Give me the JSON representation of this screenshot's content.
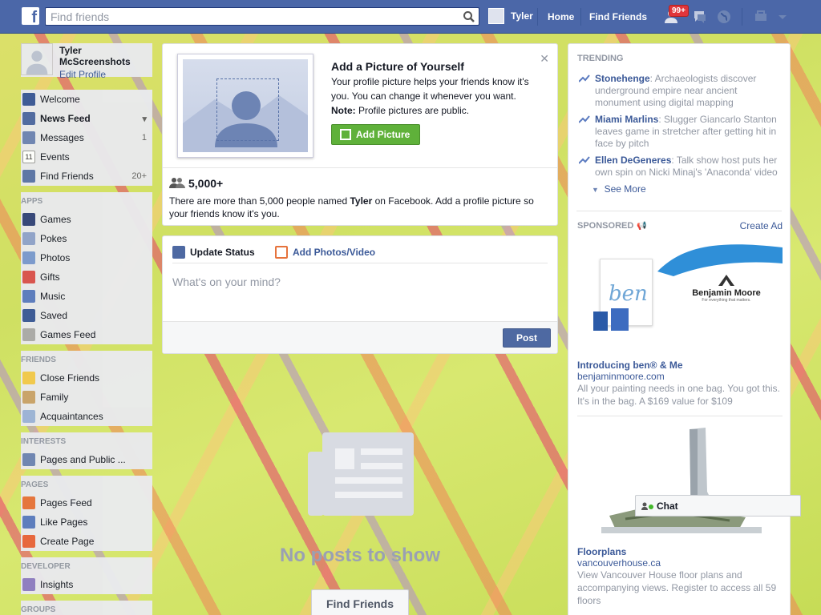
{
  "topbar": {
    "logo": "f",
    "search_placeholder": "Find friends",
    "user_name": "Tyler",
    "home_label": "Home",
    "find_friends_label": "Find Friends",
    "friend_requests_badge": "99+"
  },
  "left": {
    "profile_name": "Tyler McScreenshots",
    "edit_profile": "Edit Profile",
    "favorites": [
      {
        "label": "Welcome",
        "icon": "facebook-icon",
        "count": ""
      },
      {
        "label": "News Feed",
        "icon": "news-feed-icon",
        "count": ""
      },
      {
        "label": "Messages",
        "icon": "messages-icon",
        "count": "1"
      },
      {
        "label": "Events",
        "icon": "calendar-icon",
        "count": ""
      },
      {
        "label": "Find Friends",
        "icon": "find-friends-icon",
        "count": "20+"
      }
    ],
    "apps_header": "APPS",
    "apps": [
      {
        "label": "Games",
        "icon": "games-icon"
      },
      {
        "label": "Pokes",
        "icon": "pokes-icon"
      },
      {
        "label": "Photos",
        "icon": "photos-icon"
      },
      {
        "label": "Gifts",
        "icon": "gifts-icon"
      },
      {
        "label": "Music",
        "icon": "music-icon"
      },
      {
        "label": "Saved",
        "icon": "saved-icon"
      },
      {
        "label": "Games Feed",
        "icon": "gamepad-icon"
      }
    ],
    "friends_header": "FRIENDS",
    "friends": [
      {
        "label": "Close Friends",
        "icon": "star-icon"
      },
      {
        "label": "Family",
        "icon": "house-icon"
      },
      {
        "label": "Acquaintances",
        "icon": "acquaintances-icon"
      }
    ],
    "interests_header": "INTERESTS",
    "interests": [
      {
        "label": "Pages and Public ...",
        "icon": "rss-icon"
      }
    ],
    "pages_header": "PAGES",
    "pages": [
      {
        "label": "Pages Feed",
        "icon": "flag-icon"
      },
      {
        "label": "Like Pages",
        "icon": "thumbs-up-icon"
      },
      {
        "label": "Create Page",
        "icon": "plus-icon"
      }
    ],
    "developer_header": "DEVELOPER",
    "developer": [
      {
        "label": "Insights",
        "icon": "insights-icon"
      }
    ],
    "groups_header": "GROUPS"
  },
  "center": {
    "pic_card": {
      "title": "Add a Picture of Yourself",
      "desc": "Your profile picture helps your friends know it's you. You can change it whenever you want.",
      "note_label": "Note:",
      "note_text": " Profile pictures are public.",
      "button": "Add Picture",
      "people_count": "5,000+",
      "people_desc_pre": "There are more than 5,000 people named ",
      "people_name": "Tyler",
      "people_desc_post": " on Facebook. Add a profile picture so your friends know it's you."
    },
    "composer": {
      "tab_status": "Update Status",
      "tab_photos": "Add Photos/Video",
      "placeholder": "What's on your mind?",
      "post_button": "Post"
    },
    "empty": {
      "text": "No posts to show",
      "button": "Find Friends"
    }
  },
  "right": {
    "trending_header": "TRENDING",
    "trending": [
      {
        "topic": "Stonehenge",
        "text": ": Archaeologists discover underground empire near ancient monument using digital mapping"
      },
      {
        "topic": "Miami Marlins",
        "text": ": Slugger Giancarlo Stanton leaves game in stretcher after getting hit in face by pitch"
      },
      {
        "topic": "Ellen DeGeneres",
        "text": ": Talk show host puts her own spin on Nicki Minaj's 'Anaconda' video"
      }
    ],
    "see_more": "See More",
    "sponsored_header": "SPONSORED",
    "create_ad": "Create Ad",
    "ads": [
      {
        "brand_logo": "Benjamin Moore",
        "brand_tagline": "For everything that matters.",
        "bag_text": "ben",
        "title": "Introducing ben® & Me",
        "url": "benjaminmoore.com",
        "desc": "All your painting needs in one bag. You got this. It's in the bag. A $169 value for $109"
      },
      {
        "title": "Floorplans",
        "url": "vancouverhouse.ca",
        "desc": "View Vancouver House floor plans and accompanying views. Register to access all 59 floors"
      }
    ]
  },
  "chat": {
    "label": "Chat"
  }
}
